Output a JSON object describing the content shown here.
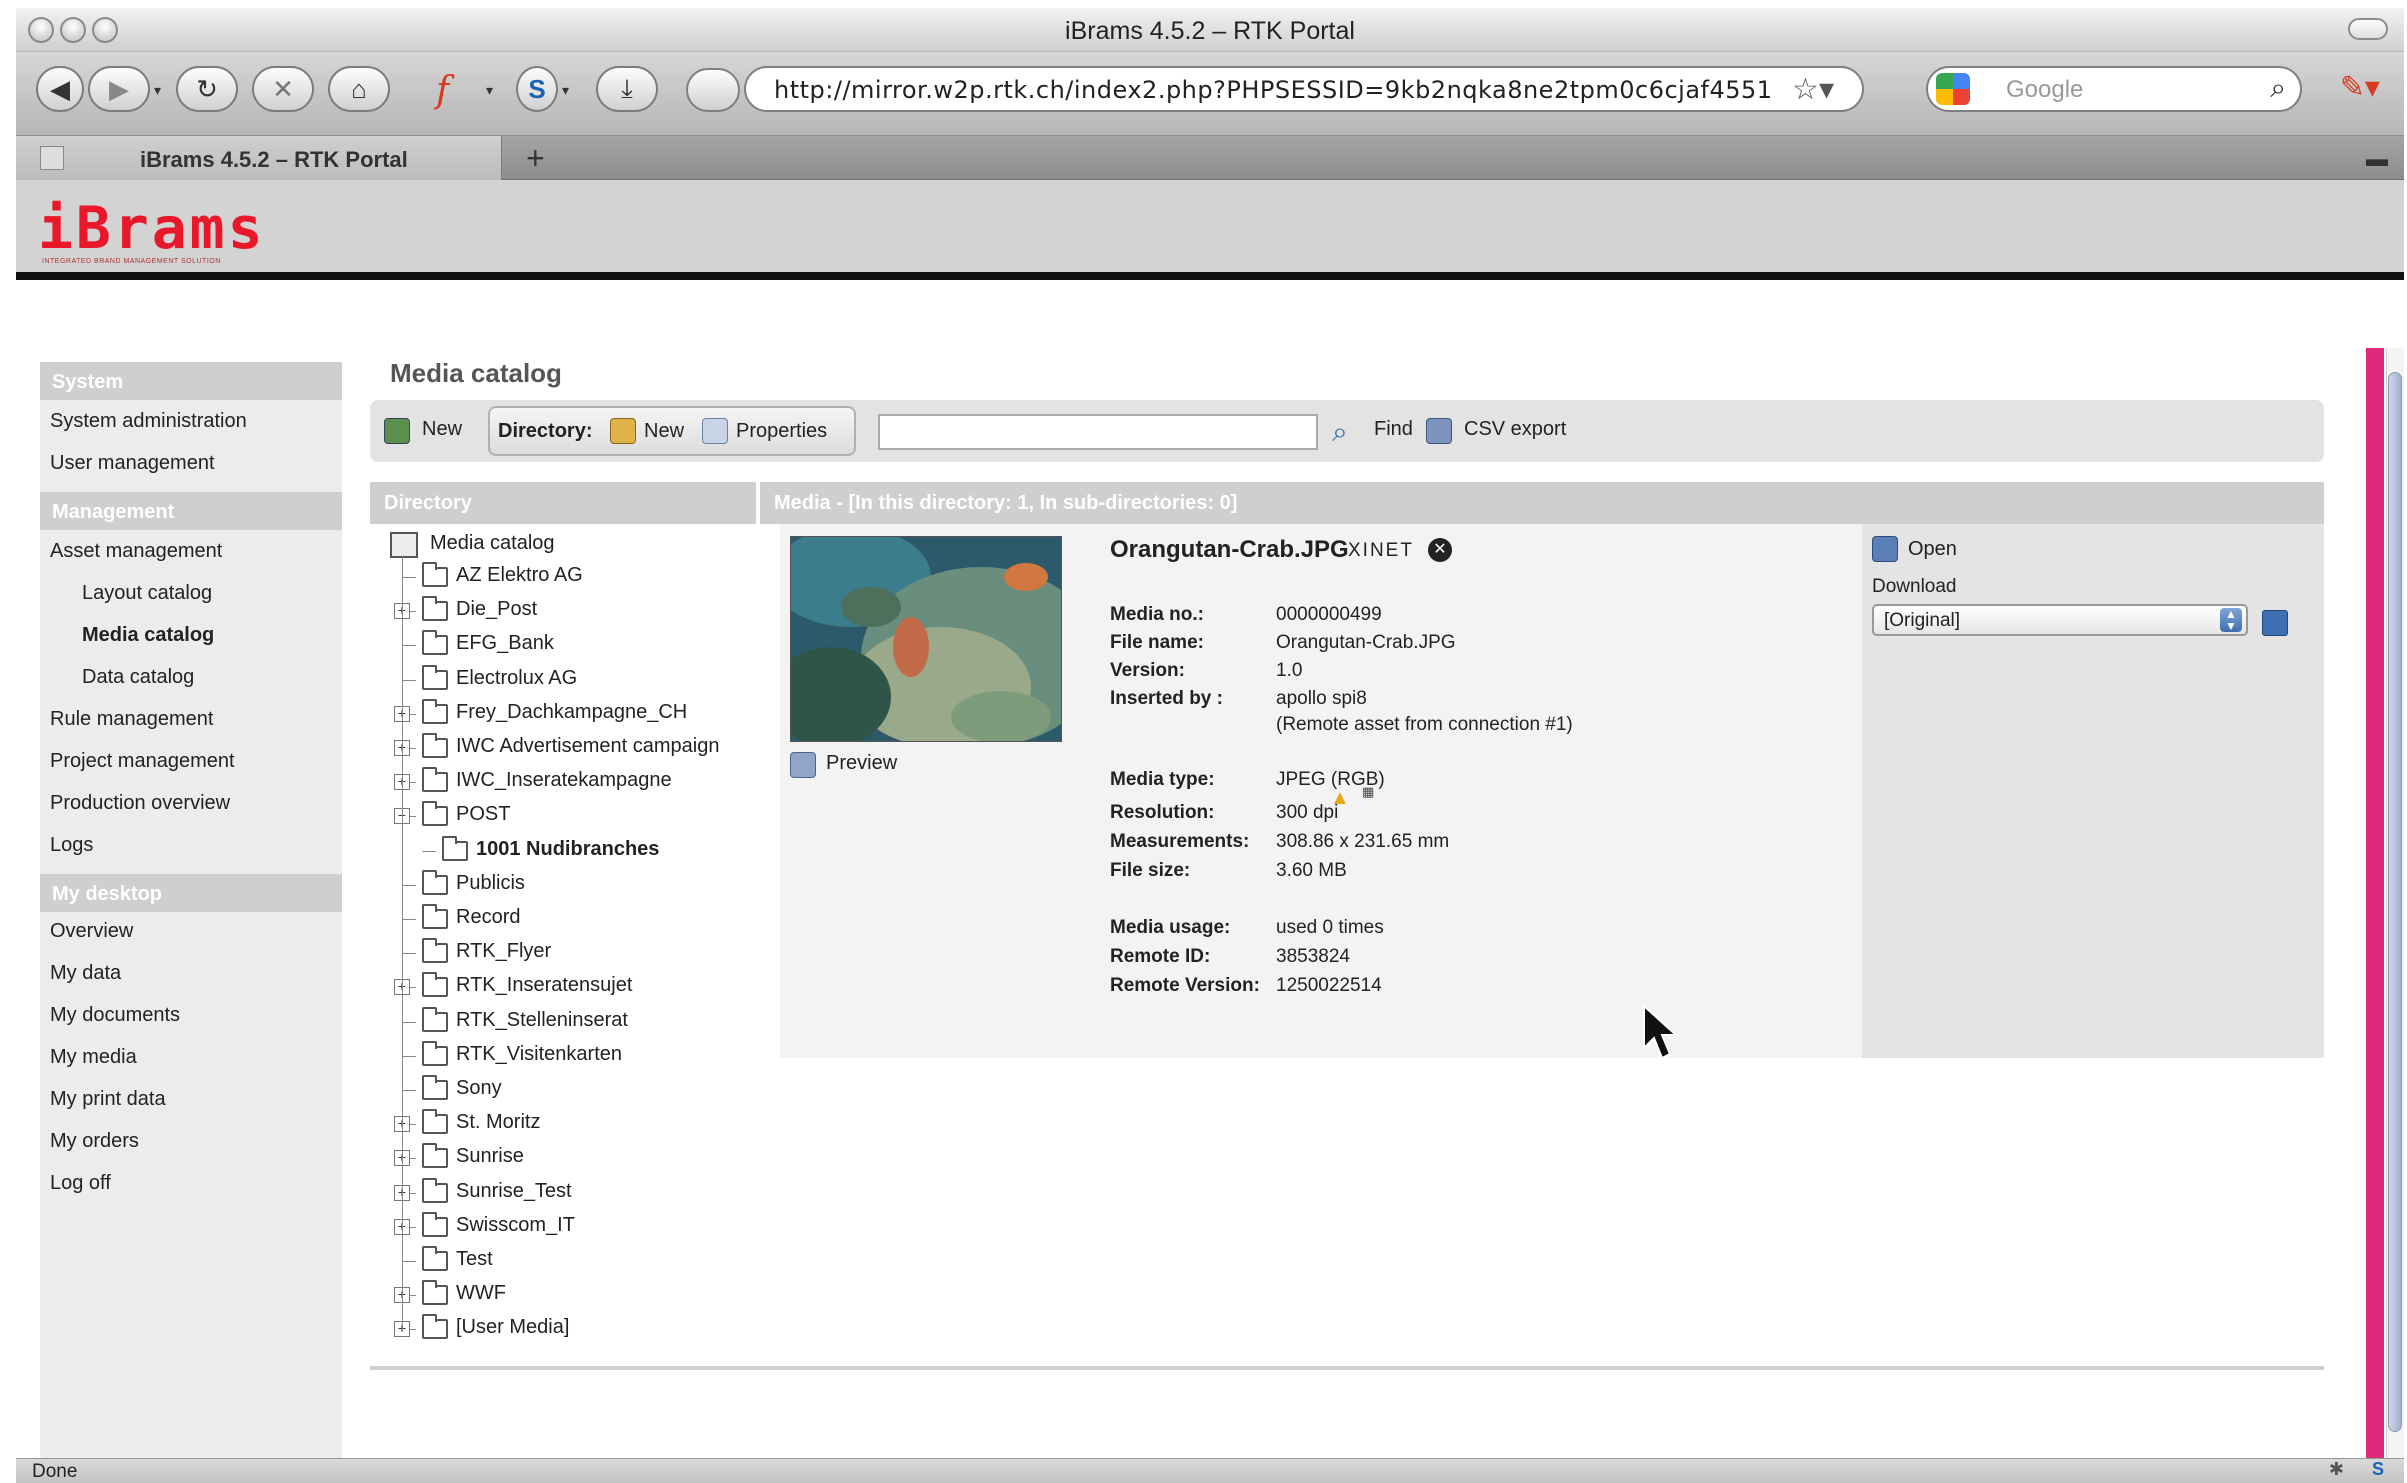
{
  "browser": {
    "window_title": "iBrams 4.5.2 – RTK Portal",
    "url": "http://mirror.w2p.rtk.ch/index2.php?PHPSESSID=9kb2nqka8ne2tpm0c6cjaf4551",
    "search_placeholder": "Google",
    "tab_title": "iBrams 4.5.2 – RTK Portal",
    "tab_new": "+",
    "status": "Done"
  },
  "header": {
    "logo": "iBrams",
    "logo_sub": "INTEGRATED BRAND MANAGEMENT SOLUTION",
    "accent_color": "#e8172a"
  },
  "sidebar": {
    "sections": [
      {
        "title": "System",
        "items": [
          "System administration",
          "User management"
        ]
      },
      {
        "title": "Management",
        "items": [
          "Asset management",
          "Layout catalog",
          "Media catalog",
          "Data catalog",
          "Rule management",
          "Project management",
          "Production overview",
          "Logs"
        ]
      },
      {
        "title": "My desktop",
        "items": [
          "Overview",
          "My data",
          "My documents",
          "My media",
          "My print data",
          "My orders",
          "Log off"
        ]
      }
    ],
    "active_item": "Media catalog"
  },
  "main": {
    "title": "Media catalog",
    "toolbar": {
      "new": "New",
      "directory_label": "Directory:",
      "dir_new": "New",
      "dir_properties": "Properties",
      "search_value": "",
      "find": "Find",
      "csv_export": "CSV export"
    },
    "directory": {
      "header": "Directory",
      "root": "Media catalog",
      "folders": [
        {
          "name": "AZ Elektro AG",
          "expandable": false
        },
        {
          "name": "Die_Post",
          "expandable": true
        },
        {
          "name": "EFG_Bank",
          "expandable": false
        },
        {
          "name": "Electrolux AG",
          "expandable": false
        },
        {
          "name": "Frey_Dachkampagne_CH",
          "expandable": true
        },
        {
          "name": "IWC Advertisement campaign",
          "expandable": true
        },
        {
          "name": "IWC_Inseratekampagne",
          "expandable": true
        },
        {
          "name": "POST",
          "expandable": true,
          "expanded": true
        },
        {
          "name": "1001 Nudibranches",
          "child": true,
          "selected": true
        },
        {
          "name": "Publicis",
          "expandable": false
        },
        {
          "name": "Record",
          "expandable": false
        },
        {
          "name": "RTK_Flyer",
          "expandable": false
        },
        {
          "name": "RTK_Inseratensujet",
          "expandable": true
        },
        {
          "name": "RTK_Stelleninserat",
          "expandable": false
        },
        {
          "name": "RTK_Visitenkarten",
          "expandable": false
        },
        {
          "name": "Sony",
          "expandable": false
        },
        {
          "name": "St. Moritz",
          "expandable": true
        },
        {
          "name": "Sunrise",
          "expandable": true
        },
        {
          "name": "Sunrise_Test",
          "expandable": true
        },
        {
          "name": "Swisscom_IT",
          "expandable": true
        },
        {
          "name": "Test",
          "expandable": false
        },
        {
          "name": "WWF",
          "expandable": true
        },
        {
          "name": "[User Media]",
          "expandable": true
        }
      ]
    },
    "media": {
      "header": "Media - [In this directory: 1, In sub-directories: 0]",
      "file_title": "Orangutan-Crab.JPG",
      "badge": "XINET",
      "preview": "Preview",
      "details": [
        {
          "label": "Media no.:",
          "value": "0000000499"
        },
        {
          "label": "File name:",
          "value": "Orangutan-Crab.JPG"
        },
        {
          "label": "Version:",
          "value": "1.0"
        },
        {
          "label": "Inserted by :",
          "value": "apollo spi8",
          "value2": "(Remote asset from connection #1)"
        },
        {
          "label": "Media type:",
          "value": "JPEG (RGB)"
        },
        {
          "label": "Resolution:",
          "value": "300 dpi"
        },
        {
          "label": "Measurements:",
          "value": "308.86 x 231.65 mm"
        },
        {
          "label": "File size:",
          "value": "3.60 MB"
        },
        {
          "label": "Media usage:",
          "value": "used 0 times"
        },
        {
          "label": "Remote ID:",
          "value": "3853824"
        },
        {
          "label": "Remote Version:",
          "value": "1250022514"
        }
      ],
      "open": "Open",
      "download_label": "Download",
      "download_option": "[Original]"
    }
  }
}
